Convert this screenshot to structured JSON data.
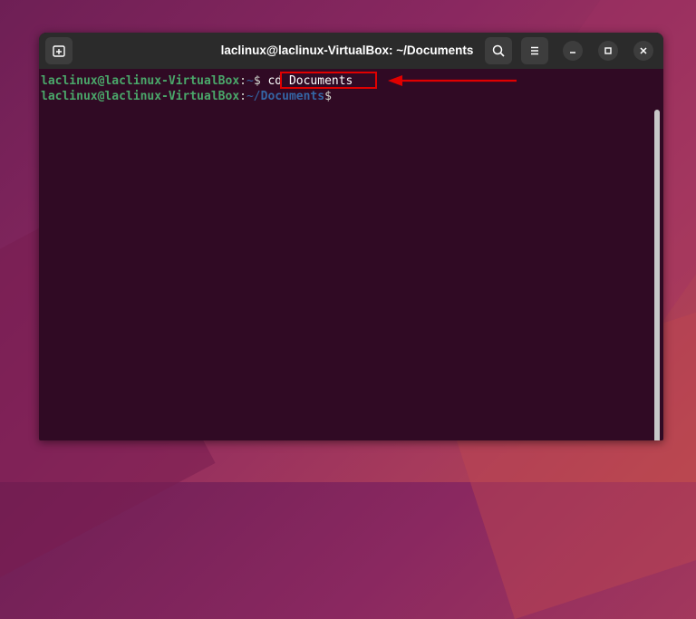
{
  "window": {
    "title": "laclinux@laclinux-VirtualBox: ~/Documents"
  },
  "terminal": {
    "lines": [
      {
        "user_host": "laclinux@laclinux-VirtualBox",
        "colon": ":",
        "path": "~",
        "dollar": "$ ",
        "command": "cd Documents"
      },
      {
        "user_host": "laclinux@laclinux-VirtualBox",
        "colon": ":",
        "path_home": "~/",
        "path_dir": "Documents",
        "dollar": "$"
      }
    ]
  },
  "annotation": {
    "color": "#e00000"
  },
  "icons": {
    "new_tab": "new-tab-icon",
    "search": "search-icon",
    "menu": "hamburger-menu-icon",
    "minimize": "minimize-icon",
    "maximize": "maximize-icon",
    "close": "close-icon"
  }
}
